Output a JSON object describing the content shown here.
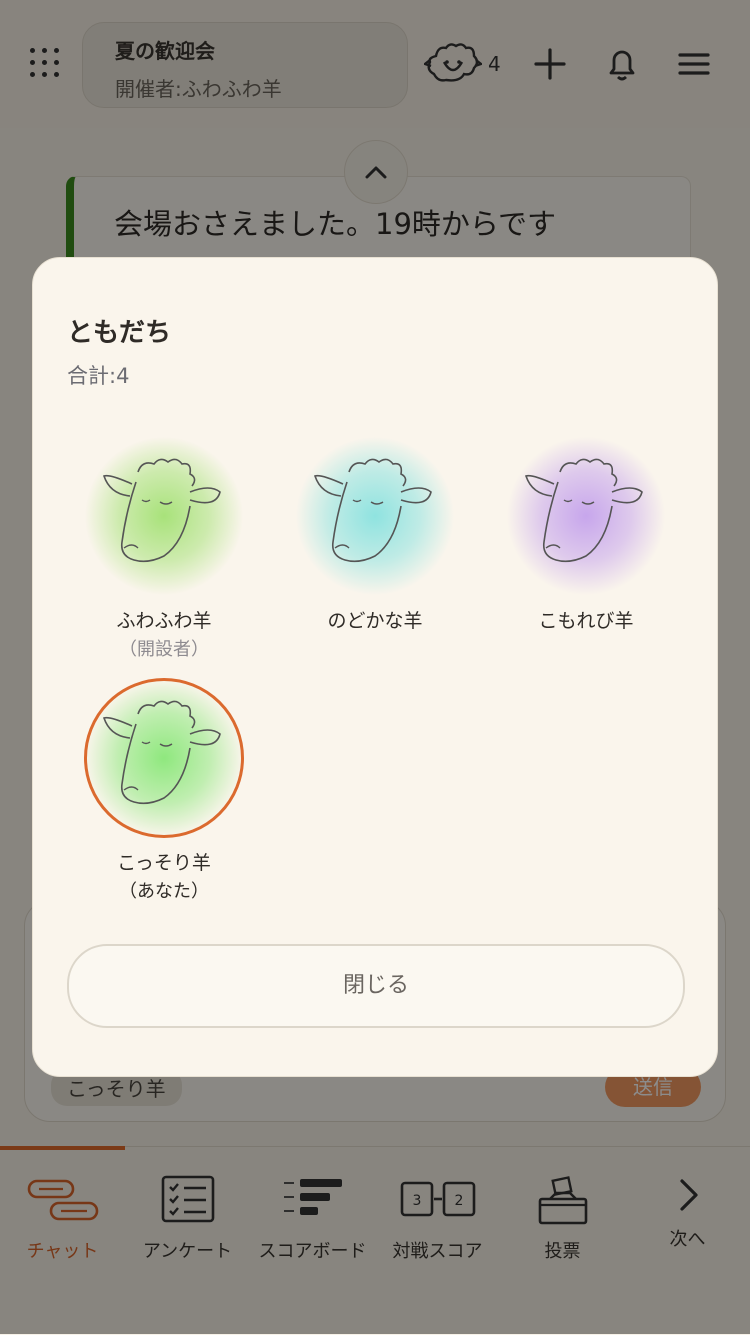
{
  "header": {
    "event_title": "夏の歓迎会",
    "organizer": "開催者:ふわふわ羊",
    "member_count": "4"
  },
  "chat": {
    "message": "会場おさえました。19時からです",
    "compose_nickname": "こっそり羊",
    "send_label": "送信"
  },
  "modal": {
    "title": "ともだち",
    "total": "合計:4",
    "friends": [
      {
        "name": "ふわふわ羊",
        "role": "（開設者）",
        "color": "#a8e27a"
      },
      {
        "name": "のどかな羊",
        "role": "",
        "color": "#8fe3e0"
      },
      {
        "name": "こもれび羊",
        "role": "",
        "color": "#c7a6ec"
      },
      {
        "name": "こっそり羊",
        "role": "（あなた）",
        "color": "#8fe87e"
      }
    ],
    "close_label": "閉じる"
  },
  "nav": {
    "active_color": "#e06a2a",
    "items": [
      {
        "label": "チャット",
        "icon": "chat-icon"
      },
      {
        "label": "アンケート",
        "icon": "checklist-icon"
      },
      {
        "label": "スコアボード",
        "icon": "scoreboard-icon"
      },
      {
        "label": "対戦スコア",
        "icon": "versus-score-icon"
      },
      {
        "label": "投票",
        "icon": "ballot-box-icon"
      },
      {
        "label": "次へ",
        "icon": "chevron-right-icon"
      }
    ],
    "versus_left": "3",
    "versus_right": "2"
  }
}
